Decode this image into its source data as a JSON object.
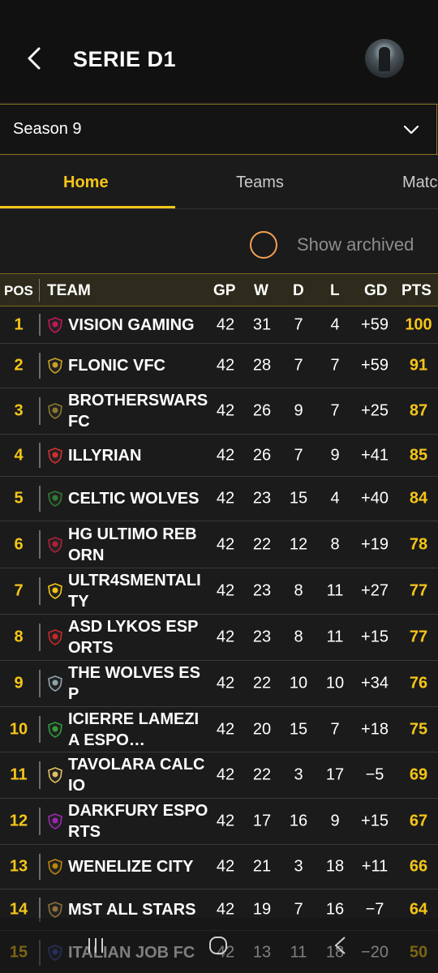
{
  "header": {
    "title": "SERIE D1",
    "back_icon": "chevron-left-icon",
    "avatar_icon": "avatar-icon"
  },
  "season": {
    "selected": "Season 9",
    "dropdown_icon": "chevron-down-icon"
  },
  "tabs": [
    {
      "label": "Home",
      "active": true
    },
    {
      "label": "Teams",
      "active": false
    },
    {
      "label": "Matc",
      "active": false
    }
  ],
  "archived": {
    "label": "Show archived",
    "checked": false
  },
  "table": {
    "headers": {
      "pos": "POS",
      "team": "TEAM",
      "gp": "GP",
      "w": "W",
      "d": "D",
      "l": "L",
      "gd": "GD",
      "pts": "PTS"
    },
    "rows": [
      {
        "pos": "1",
        "team": "VISION GAMING",
        "gp": "42",
        "w": "31",
        "d": "7",
        "l": "4",
        "gd": "+59",
        "pts": "100",
        "logo_color": "#c2185b"
      },
      {
        "pos": "2",
        "team": "FLONIC VFC",
        "gp": "42",
        "w": "28",
        "d": "7",
        "l": "7",
        "gd": "+59",
        "pts": "91",
        "logo_color": "#c9a227"
      },
      {
        "pos": "3",
        "team": "BROTHERSWARS FC",
        "gp": "42",
        "w": "26",
        "d": "9",
        "l": "7",
        "gd": "+25",
        "pts": "87",
        "logo_color": "#8b7a2a"
      },
      {
        "pos": "4",
        "team": "ILLYRIAN",
        "gp": "42",
        "w": "26",
        "d": "7",
        "l": "9",
        "gd": "+41",
        "pts": "85",
        "logo_color": "#d32f2f"
      },
      {
        "pos": "5",
        "team": "CELTIC WOLVES",
        "gp": "42",
        "w": "23",
        "d": "15",
        "l": "4",
        "gd": "+40",
        "pts": "84",
        "logo_color": "#2e7d32"
      },
      {
        "pos": "6",
        "team": "HG ULTIMO REBORN",
        "gp": "42",
        "w": "22",
        "d": "12",
        "l": "8",
        "gd": "+19",
        "pts": "78",
        "logo_color": "#b0203a"
      },
      {
        "pos": "7",
        "team": "ULTR4SMENTALI TY",
        "gp": "42",
        "w": "23",
        "d": "8",
        "l": "11",
        "gd": "+27",
        "pts": "77",
        "logo_color": "#f5c518"
      },
      {
        "pos": "8",
        "team": "ASD LYKOS ESPORTS",
        "gp": "42",
        "w": "23",
        "d": "8",
        "l": "11",
        "gd": "+15",
        "pts": "77",
        "logo_color": "#c62828"
      },
      {
        "pos": "9",
        "team": "THE WOLVES ESP",
        "gp": "42",
        "w": "22",
        "d": "10",
        "l": "10",
        "gd": "+34",
        "pts": "76",
        "logo_color": "#90a4ae"
      },
      {
        "pos": "10",
        "team": "ICIERRE LAMEZIA ESPO…",
        "gp": "42",
        "w": "20",
        "d": "15",
        "l": "7",
        "gd": "+18",
        "pts": "75",
        "logo_color": "#2e9c3a"
      },
      {
        "pos": "11",
        "team": "TAVOLARA CALCIO",
        "gp": "42",
        "w": "22",
        "d": "3",
        "l": "17",
        "gd": "−5",
        "pts": "69",
        "logo_color": "#e0c060"
      },
      {
        "pos": "12",
        "team": "DARKFURY ESPORTS",
        "gp": "42",
        "w": "17",
        "d": "16",
        "l": "9",
        "gd": "+15",
        "pts": "67",
        "logo_color": "#9c27b0"
      },
      {
        "pos": "13",
        "team": "WENELIZE CITY",
        "gp": "42",
        "w": "21",
        "d": "3",
        "l": "18",
        "gd": "+11",
        "pts": "66",
        "logo_color": "#b8860b"
      },
      {
        "pos": "14",
        "team": "MST ALL STARS",
        "gp": "42",
        "w": "19",
        "d": "7",
        "l": "16",
        "gd": "−7",
        "pts": "64",
        "logo_color": "#8d6e3b"
      },
      {
        "pos": "15",
        "team": "ITALIAN JOB FC",
        "gp": "42",
        "w": "13",
        "d": "11",
        "l": "18",
        "gd": "−20",
        "pts": "50",
        "logo_color": "#3f51b5"
      }
    ]
  },
  "navbar": {
    "recents_icon": "recent-apps-icon",
    "home_icon": "home-icon",
    "back_icon": "back-icon"
  }
}
